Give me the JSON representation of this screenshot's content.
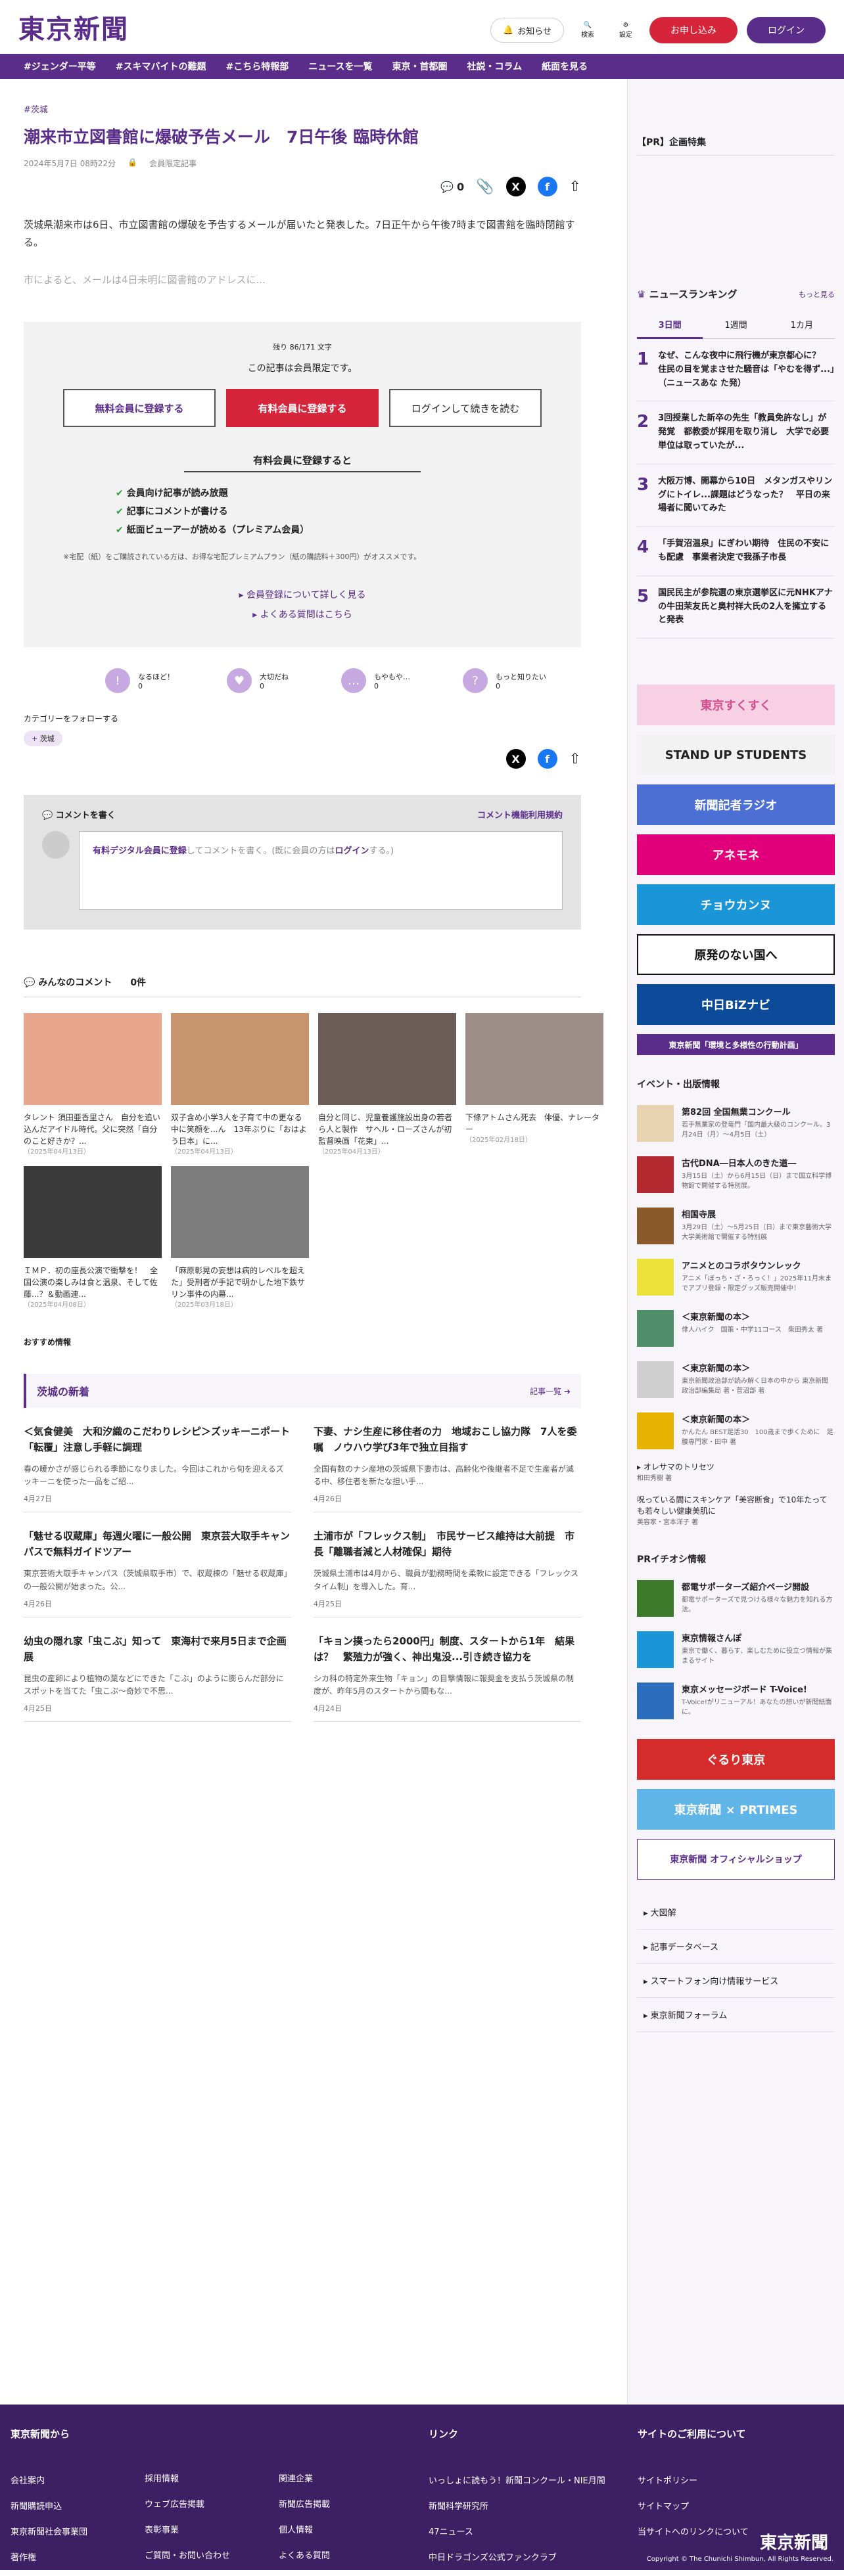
{
  "header": {
    "logo": "東京新聞",
    "notice": "お知らせ",
    "search": "検索",
    "settings": "設定",
    "apply": "お申し込み",
    "login": "ログイン"
  },
  "nav": [
    "#ジェンダー平等",
    "#スキマバイトの難題",
    "#こちら特報部",
    "ニュースを一覧",
    "東京・首都圏",
    "社説・コラム",
    "紙面を見る"
  ],
  "article": {
    "tag": "#茨城",
    "title": "潮来市立図書館に爆破予告メール　7日午後 臨時休館",
    "date": "2024年5月7日 08時22分",
    "badge": "会員限定記事",
    "comment_count": "0",
    "p1": "茨城県潮来市は6日、市立図書館の爆破を予告するメールが届いたと発表した。7日正午から午後7時まで図書館を臨時閉館する。",
    "p2": "市によると、メールは4日未明に図書館のアドレスに..."
  },
  "paywall": {
    "remain": "残り 86/171 文字",
    "limited": "この記事は会員限定です。",
    "free": "無料会員に登録する",
    "paid": "有料会員に登録する",
    "continue": "ログインして続きを読む",
    "benefit_title": "有料会員に登録すると",
    "benefits": [
      "会員向け記事が読み放題",
      "記事にコメントが書ける",
      "紙面ビューアーが読める（プレミアム会員）"
    ],
    "note": "※宅配（紙）をご購読されている方は、お得な宅配プレミアムプラン（紙の購読料＋300円）がオススメです。",
    "link1": "会員登録について詳しく見る",
    "link2": "よくある質問はこちら"
  },
  "reactions": [
    {
      "label": "なるほど！",
      "count": "0"
    },
    {
      "label": "大切だね",
      "count": "0"
    },
    {
      "label": "もやもや…",
      "count": "0"
    },
    {
      "label": "もっと知りたい",
      "count": "0"
    }
  ],
  "follow": {
    "title": "カテゴリーをフォローする",
    "tag": "茨城"
  },
  "comment": {
    "write": "コメントを書く",
    "rules": "コメント機能利用規約",
    "hint_link": "有料デジタル会員に登録",
    "hint": "してコメントを書く。(既に会員の方は",
    "login": "ログイン",
    "end": "する。)"
  },
  "all_comments": {
    "title": "みんなのコメント",
    "count": "0件"
  },
  "thumbs": [
    {
      "text": "タレント 須田亜香里さん　自分を追い込んだアイドル時代。父に突然「自分のこと好きか？...",
      "date": "（2025年04月13日）",
      "color": "#e8a78c"
    },
    {
      "text": "双子含め小学3人を子育て中の更なる中に笑顔を...ん　13年ぶりに「おはよう日本」に...",
      "date": "（2025年04月13日）",
      "color": "#c9956f"
    },
    {
      "text": "自分と同じ、児童養護施設出身の若者ら人と製作　サヘル・ローズさんが初監督映画「花束」...",
      "date": "（2025年04月13日）",
      "color": "#6b5d56"
    },
    {
      "text": "下條アトムさん死去　俳優、ナレーター",
      "date": "（2025年02月18日）",
      "color": "#9a8e86"
    },
    {
      "text": "ＩＭＰ．初の座長公演で衝撃を！　全国公演の楽しみは食と温泉、そして佐藤...？＆動画連...",
      "date": "（2025年04月08日）",
      "color": "#3a3a3a"
    },
    {
      "text": "「麻原彰晃の妄想は病的レベルを超えた」受刑者が手記で明かした地下鉄サリン事件の内幕...",
      "date": "（2025年03月18日）",
      "color": "#7d7d7d"
    }
  ],
  "recommend": "おすすめ情報",
  "local": {
    "title": "茨城の新着",
    "more": "記事一覧"
  },
  "news": [
    {
      "title": "＜気食健美　大和汐織のこだわりレシピ＞ズッキーニポート「転覆」注意し手軽に調理",
      "text": "春の暖かさが感じられる季節になりました。今回はこれから旬を迎えるズッキーニを使った一品をご紹...",
      "date": "4月27日"
    },
    {
      "title": "下妻、ナシ生産に移住者の力　地域おこし協力隊　7人を委嘱　ノウハウ学び3年で独立目指す",
      "text": "全国有数のナシ産地の茨城県下妻市は、高齢化や後継者不足で生産者が減る中、移住者を新たな担い手...",
      "date": "4月26日"
    },
    {
      "title": "「魅せる収蔵庫」毎週火曜に一般公開　東京芸大取手キャンパスで無料ガイドツアー",
      "text": "東京芸術大取手キャンパス（茨城県取手市）で、収蔵棟の「魅せる収蔵庫」の一般公開が始まった。公...",
      "date": "4月26日"
    },
    {
      "title": "土浦市が「フレックス制」　市民サービス維持は大前提　市長「離職者減と人材確保」期待",
      "text": "茨城県土浦市は4月から、職員が勤務時間を柔軟に設定できる「フレックスタイム制」を導入した。育...",
      "date": "4月25日"
    },
    {
      "title": "幼虫の隠れ家「虫こぶ」知って　東海村で来月5日まで企画展",
      "text": "昆虫の産卵により植物の葉などにできた「こぶ」のように膨らんだ部分にスポットを当てた「虫こぶ～奇妙で不思...",
      "date": "4月25日"
    },
    {
      "title": "「キョン撲ったら2000円」制度、スタートから1年　結果は？　繁殖力が強く、神出鬼没...引き続き協力を",
      "text": "シカ科の特定外来生物「キョン」の目撃情報に報奨金を支払う茨城県の制度が、昨年5月のスタートから間もな...",
      "date": "4月24日"
    }
  ],
  "side": {
    "pr": "【PR】企画特集",
    "ranking_title": "ニュースランキング",
    "ranking_more": "もっと見る",
    "tabs": [
      "3日間",
      "1週間",
      "1カ月"
    ],
    "ranks": [
      "なぜ、こんな夜中に飛行機が東京都心に？　住民の目を覚まさせた騒音は「やむを得ず...」（ニュースあな た発）",
      "3回授業した新卒の先生「教員免許なし」が発覚　都教委が採用を取り消し　大学で必要単位は取っていたが...",
      "大阪万博、開幕から10日　メタンガスやリングにトイレ...課題はどうなった？　平日の来場者に聞いてみた",
      "「手賀沼温泉」にぎわい期待　住民の不安にも配慮　事業者決定で我孫子市長",
      "国民民主が参院選の東京選挙区に元NHKアナの牛田茉友氏と奥村祥大氏の2人を擁立すると発表"
    ],
    "banners": [
      {
        "text": "東京すくすく",
        "bg": "#f7d0e3",
        "fg": "#d14d8b"
      },
      {
        "text": "STAND UP STUDENTS",
        "bg": "#f2f2f2",
        "fg": "#222"
      },
      {
        "text": "新聞記者ラジオ",
        "bg": "#4c6fd6",
        "fg": "#fff"
      },
      {
        "text": "アネモネ",
        "bg": "#e2007a",
        "fg": "#fff"
      },
      {
        "text": "チョウカンヌ",
        "bg": "#1a96d8",
        "fg": "#fff"
      },
      {
        "text": "原発のない国へ",
        "bg": "#fff",
        "fg": "#111"
      },
      {
        "text": "中日BiZナビ",
        "bg": "#0c4a9a",
        "fg": "#fff"
      },
      {
        "text": "東京新聞「環境と多様性の行動計画」",
        "bg": "#5a2d8a",
        "fg": "#fff"
      }
    ],
    "events_title": "イベント・出版情報",
    "events": [
      {
        "t": "第82回 全国無業コンクール",
        "s": "若手無業家の登竜門「国内最大級のコンクール。3月24日（月）～4月5日（土）",
        "c": "#e7d2b1"
      },
      {
        "t": "古代DNA―日本人のきた道―",
        "s": "3月15日（土）から6月15日（日）まで国立科学博物館で開催する特別展。",
        "c": "#b3292f"
      },
      {
        "t": "相国寺展",
        "s": "3月29日（土）～5月25日（日）まで東京藝術大学大学美術館で開催する特別展",
        "c": "#8a5a2a"
      },
      {
        "t": "アニメとのコラボタウンレック",
        "s": "アニメ「ぼっち・ざ・ろっく！」2025年11月末までアプリ登録・限定グッズ販売開催中！",
        "c": "#ede23a"
      },
      {
        "t": "＜東京新聞の本＞",
        "s": "俳人ハイク　国策・中学11コース　柴田秀太 著",
        "c": "#4e8f6a"
      },
      {
        "t": "＜東京新聞の本＞",
        "s": "東京新聞政治部が読み解く日本の中から 東京新聞政治部編集局 著・菅沼部 著",
        "c": "#cfcfcf"
      },
      {
        "t": "＜東京新聞の本＞",
        "s": "かんたん BEST足活30　100歳まで歩くために　足腰専門家・田中 著",
        "c": "#e7b300"
      }
    ],
    "col_links": [
      {
        "t": "オレサマのトリセツ",
        "s": "和田秀樹 著"
      },
      {
        "t": "呪っている間にスキンケア「美容断食」で10年たっても若々しい健康美肌に",
        "s": "美容家・宮本洋子 著"
      }
    ],
    "pr_title": "PRイチオシ情報",
    "pr_items": [
      {
        "t": "都電サポーターズ紹介ページ開設",
        "s": "都電サポーターズで見つける様々な魅力を知れる方法。",
        "c": "#3b7b2a"
      },
      {
        "t": "東京情報さんぽ",
        "s": "東京で働く、暮らす、楽しむために役立つ情報が集まるサイト",
        "c": "#1a96d8"
      },
      {
        "t": "東京メッセージボード T-Voice!",
        "s": "T-Voice!がリニューアル！あなたの想いが新聞紙面に。",
        "c": "#2a6dbd"
      }
    ],
    "bottom_banners": [
      {
        "text": "ぐるり東京",
        "bg": "#d62b2b"
      },
      {
        "text": "東京新聞 × PRTIMES",
        "bg": "#5fb4e8"
      },
      {
        "text": "東京新聞 オフィシャルショップ",
        "bg": "#fff"
      }
    ],
    "links": [
      "大図解",
      "記事データベース",
      "スマートフォン向け情報サービス",
      "東京新聞フォーラム"
    ]
  },
  "footer": {
    "col1": "東京新聞から",
    "col1_items": [
      "会社案内",
      "新聞購読申込",
      "東京新聞社会事業団",
      "著作権"
    ],
    "col1b": [
      "採用情報",
      "ウェブ広告掲載",
      "表彰事業",
      "ご質問・お問い合わせ"
    ],
    "col1c": [
      "関連企業",
      "新聞広告掲載",
      "個人情報",
      "よくある質問"
    ],
    "col2": "リンク",
    "col2_items": [
      "いっしょに読もう！新聞コンクール・NIE月間",
      "新聞科学研究所",
      "47ニュース",
      "中日ドラゴンズ公式ファンクラブ"
    ],
    "col3": "サイトのご利用について",
    "col3_items": [
      "サイトポリシー",
      "サイトマップ",
      "当サイトへのリンクについて"
    ],
    "logo": "東京新聞",
    "copyright": "Copyright © The Chunichi Shimbun, All Rights Reserved."
  }
}
